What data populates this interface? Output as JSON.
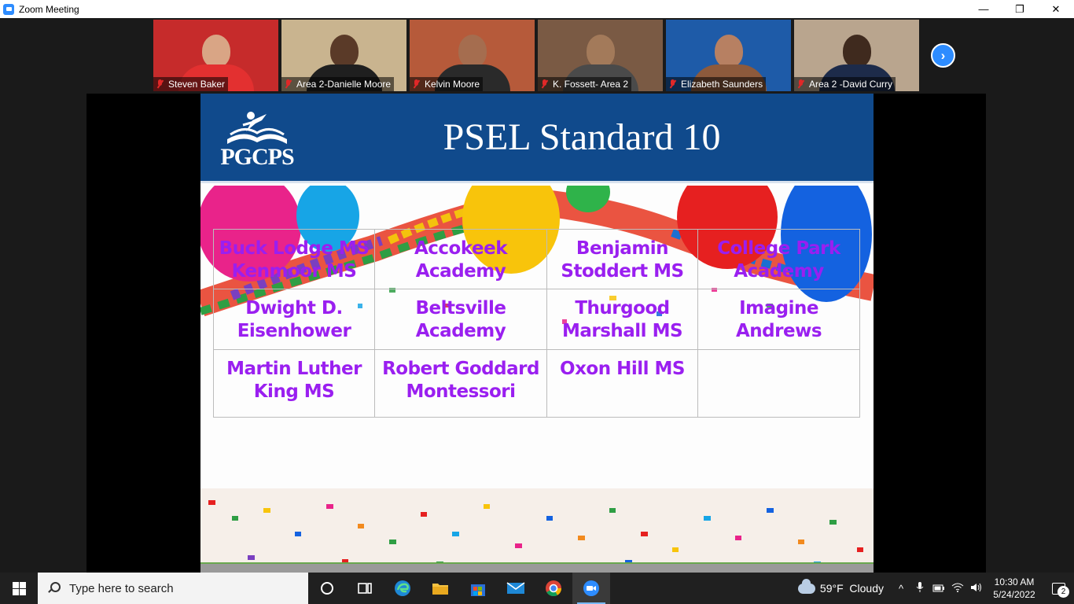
{
  "window": {
    "title": "Zoom Meeting",
    "minimize": "—",
    "restore": "❐",
    "close": "✕"
  },
  "participants": [
    {
      "name": "Steven Baker",
      "bg": "#c62b2b",
      "skin": "#d9a585",
      "shirt": "#e33030"
    },
    {
      "name": "Area 2-Danielle Moore",
      "bg": "#c9b48f",
      "skin": "#5a3a28",
      "shirt": "#1f1f1f"
    },
    {
      "name": "Kelvin Moore",
      "bg": "#b65a3a",
      "skin": "#a56d4f",
      "shirt": "#2a2a2a"
    },
    {
      "name": "K. Fossett- Area 2",
      "bg": "#7a5a44",
      "skin": "#a37a5a",
      "shirt": "#4a4a4a"
    },
    {
      "name": "Elizabeth Saunders",
      "bg": "#1e5ba8",
      "skin": "#b78062",
      "shirt": "#8d5a3c"
    },
    {
      "name": "Area 2 -David Curry",
      "bg": "#b9a58e",
      "skin": "#3f2a1e",
      "shirt": "#1d2b4a"
    }
  ],
  "next_button": "›",
  "slide": {
    "logo_text": "PGCPS",
    "title": "PSEL Standard 10",
    "schools": [
      [
        "Buck Lodge MS",
        "Kenmoor MS"
      ],
      [
        "Accokeek",
        "Academy"
      ],
      [
        "Benjamin",
        "Stoddert MS"
      ],
      [
        "College Park",
        "Academy"
      ],
      [
        "Dwight D.",
        "Eisenhower"
      ],
      [
        "Beltsville",
        "Academy"
      ],
      [
        "Thurgood",
        "Marshall MS"
      ],
      [
        "Imagine",
        "Andrews"
      ],
      [
        "Martin Luther",
        "King MS"
      ],
      [
        "Robert Goddard",
        "Montessori"
      ],
      [
        "Oxon Hill MS"
      ],
      []
    ]
  },
  "taskbar": {
    "search_placeholder": "Type here to search",
    "weather": "59°F  Cloudy",
    "time": "10:30 AM",
    "date": "5/24/2022",
    "notifications": "2"
  },
  "colors": {
    "slide_header": "#104a8c",
    "school_text": "#9a1ff0",
    "zoom_blue": "#2d8cff"
  }
}
